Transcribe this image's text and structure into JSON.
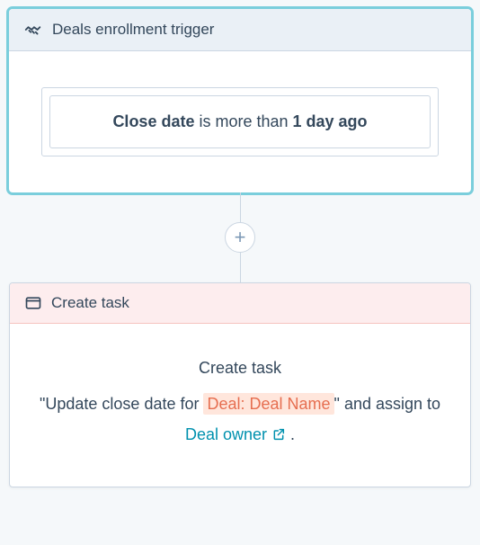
{
  "trigger": {
    "title": "Deals enrollment trigger",
    "criteria": {
      "property": "Close date",
      "operator_text": " is more than ",
      "value": "1 day ago"
    }
  },
  "addStep": {
    "label": "+"
  },
  "action": {
    "title": "Create task",
    "summary": {
      "heading": "Create task",
      "quote_open": "\"",
      "task_prefix": "Update close date for ",
      "token": "Deal: Deal Name",
      "quote_close": "\"",
      "and_text": " and assign to ",
      "assignee": "Deal owner",
      "period": " ."
    }
  }
}
